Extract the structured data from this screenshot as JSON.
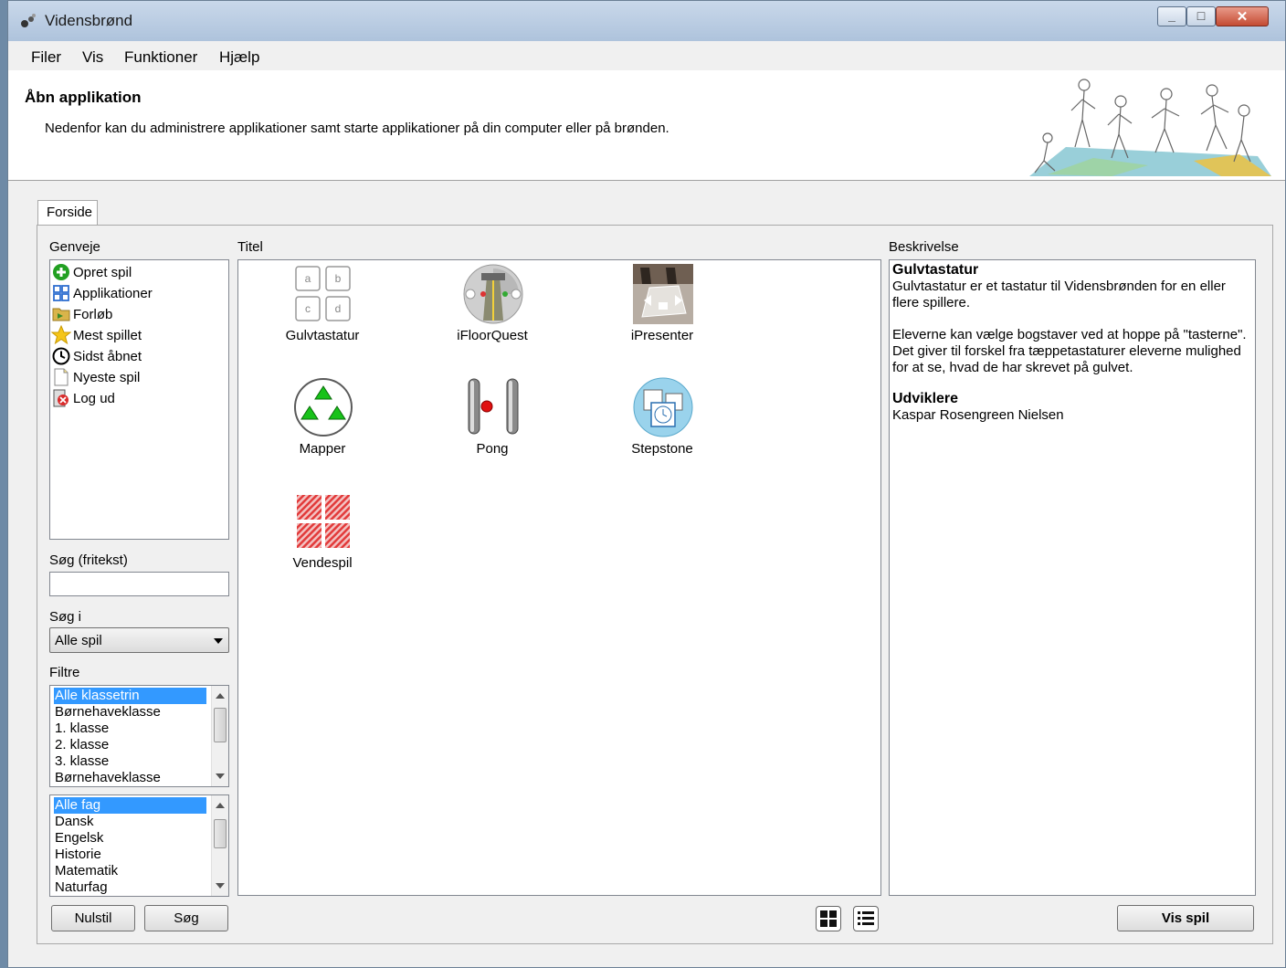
{
  "window": {
    "title": "Vidensbrønd"
  },
  "menu": [
    "Filer",
    "Vis",
    "Funktioner",
    "Hjælp"
  ],
  "header": {
    "title": "Åbn applikation",
    "subtitle": "Nedenfor kan du administrere applikationer samt starte applikationer på din computer eller på brønden."
  },
  "tab": {
    "label": "Forside"
  },
  "shortcuts": {
    "label": "Genveje",
    "items": [
      {
        "label": "Opret spil",
        "icon": "plus-icon"
      },
      {
        "label": "Applikationer",
        "icon": "grid-icon"
      },
      {
        "label": "Forløb",
        "icon": "folder-icon"
      },
      {
        "label": "Mest spillet",
        "icon": "star-icon"
      },
      {
        "label": "Sidst åbnet",
        "icon": "clock-icon"
      },
      {
        "label": "Nyeste spil",
        "icon": "document-icon"
      },
      {
        "label": "Log ud",
        "icon": "logout-icon"
      }
    ]
  },
  "search": {
    "label": "Søg (fritekst)",
    "value": "",
    "in_label": "Søg i",
    "in_value": "Alle spil"
  },
  "filters": {
    "label": "Filtre",
    "grades": [
      "Alle klassetrin",
      "Børnehaveklasse",
      "1. klasse",
      "2. klasse",
      "3. klasse",
      "Børnehaveklasse"
    ],
    "grades_selected": 0,
    "subjects": [
      "Alle fag",
      "Dansk",
      "Engelsk",
      "Historie",
      "Matematik",
      "Naturfag"
    ],
    "subjects_selected": 0
  },
  "buttons": {
    "reset": "Nulstil",
    "search": "Søg",
    "show": "Vis spil"
  },
  "apps": {
    "column_label": "Titel",
    "items": [
      {
        "label": "Gulvtastatur",
        "icon": "keyboard-tiles-icon"
      },
      {
        "label": "iFloorQuest",
        "icon": "quest-icon"
      },
      {
        "label": "iPresenter",
        "icon": "presenter-photo-icon"
      },
      {
        "label": "Mapper",
        "icon": "triangles-icon"
      },
      {
        "label": "Pong",
        "icon": "pong-icon"
      },
      {
        "label": "Stepstone",
        "icon": "stepstone-icon"
      },
      {
        "label": "Vendespil",
        "icon": "memory-cards-icon"
      }
    ]
  },
  "description": {
    "label": "Beskrivelse",
    "heading": "Gulvtastatur",
    "text1": "Gulvtastatur er et tastatur til Vidensbrønden for en eller flere spillere.",
    "text2": "Eleverne kan vælge bogstaver ved at hoppe på \"tasterne\". Det giver til forskel fra tæppetastaturer eleverne mulighed for at se, hvad de har skrevet på gulvet.",
    "dev_heading": "Udviklere",
    "dev_name": "Kaspar Rosengreen Nielsen"
  },
  "colors": {
    "selection": "#3399ff",
    "titlebar": "#b9cce3"
  }
}
